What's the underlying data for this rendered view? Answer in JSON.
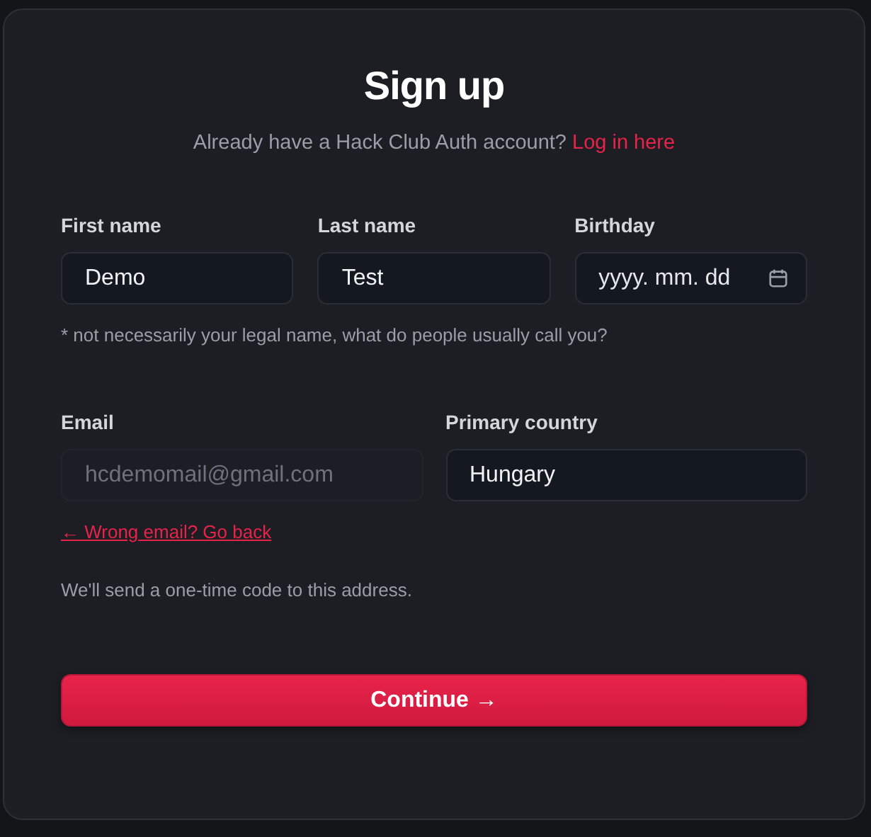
{
  "title": "Sign up",
  "subtitle": {
    "text": "Already have a Hack Club Auth account?",
    "link": "Log in here"
  },
  "name_fields": [
    {
      "kind": "text",
      "label": "First name",
      "value": "Demo",
      "disabled": false
    },
    {
      "kind": "text",
      "label": "Last name",
      "value": "Test",
      "disabled": false
    },
    {
      "kind": "date",
      "label": "Birthday",
      "placeholder": "yyyy. mm. dd"
    }
  ],
  "name_hint": "* not necessarily your legal name, what do people usually call you?",
  "contact_fields": [
    {
      "label": "Email",
      "value": "hcdemomail@gmail.com",
      "disabled": true
    },
    {
      "label": "Primary country",
      "value": "Hungary",
      "disabled": false
    }
  ],
  "back_link": "← Wrong email? Go back",
  "note": "We'll send a one-time code to this address.",
  "submit": "Continue →"
}
